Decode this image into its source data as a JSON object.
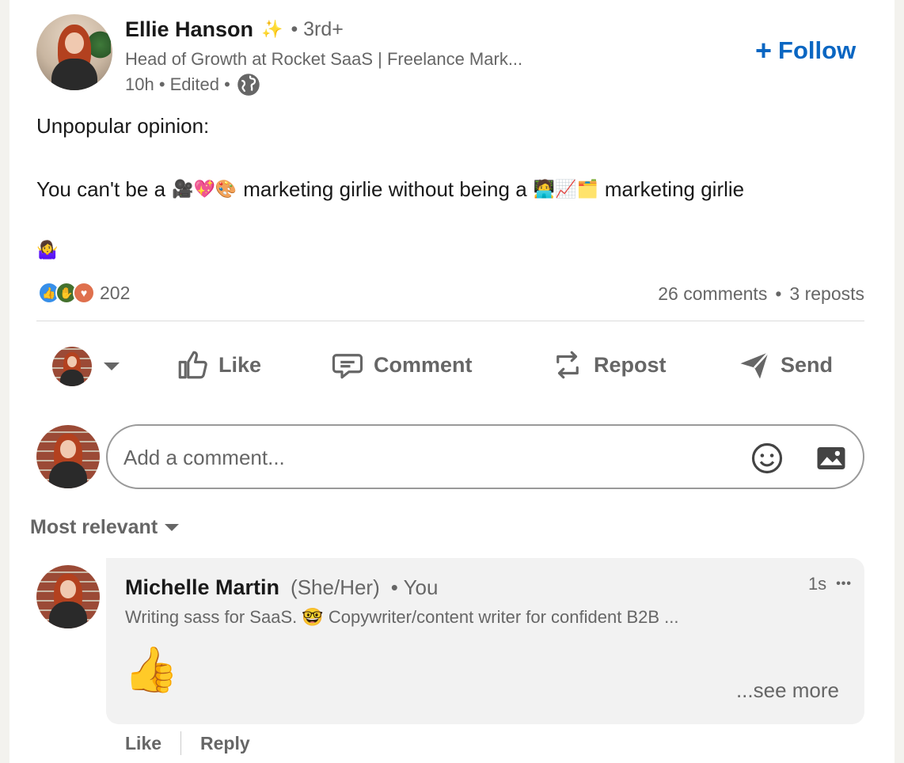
{
  "post": {
    "author": {
      "name": "Ellie Hanson",
      "sparkle": "✨",
      "degree": "• 3rd+",
      "headline": "Head of Growth at Rocket SaaS | Freelance Mark...",
      "time": "10h • Edited •",
      "visibility_icon": "globe-icon"
    },
    "follow_label": "Follow",
    "text": {
      "line1": "Unpopular opinion:",
      "line2_a": "You can't be a",
      "line2_emojis_a": "🎥💖🎨",
      "line2_b": "marketing girlie without being a",
      "line2_emojis_b": "🧑‍💻📈🗂️",
      "line2_c": "marketing girlie",
      "line3": "🤷‍♀️"
    },
    "reactions": {
      "types": [
        "like",
        "support",
        "love"
      ],
      "count": "202"
    },
    "stats": {
      "comments": "26 comments",
      "separator": "•",
      "reposts": "3 reposts"
    }
  },
  "actions": {
    "like": "Like",
    "comment": "Comment",
    "repost": "Repost",
    "send": "Send"
  },
  "comment_input": {
    "placeholder": "Add a comment..."
  },
  "sort": {
    "label": "Most relevant"
  },
  "comment": {
    "name": "Michelle Martin",
    "pronouns": "(She/Her)",
    "you": "• You",
    "headline": "Writing sass for SaaS. 🤓 Copywriter/content writer for confident B2B ...",
    "time": "1s",
    "more": "•••",
    "body": "👍",
    "see_more": "...see more",
    "like": "Like",
    "reply": "Reply"
  },
  "colors": {
    "accent": "#0a66c2",
    "muted": "#666666",
    "background": "#f3f2ee"
  }
}
